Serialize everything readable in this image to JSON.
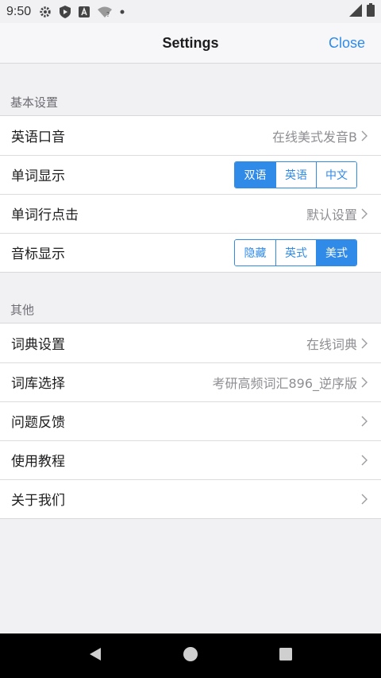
{
  "status_bar": {
    "time": "9:50",
    "icons": [
      "gear-icon",
      "play-shield-icon",
      "a-box-icon",
      "wifi-question-icon",
      "dot-icon"
    ],
    "right_icons": [
      "signal-icon",
      "battery-icon"
    ]
  },
  "nav": {
    "title": "Settings",
    "close_label": "Close"
  },
  "sections": [
    {
      "header": "基本设置",
      "rows": [
        {
          "label": "英语口音",
          "value": "在线美式发音B"
        },
        {
          "label": "单词显示",
          "options": [
            "双语",
            "英语",
            "中文"
          ],
          "selected": "双语"
        },
        {
          "label": "单词行点击",
          "value": "默认设置"
        },
        {
          "label": "音标显示",
          "options": [
            "隐藏",
            "英式",
            "美式"
          ],
          "selected": "美式"
        }
      ]
    },
    {
      "header": "其他",
      "rows": [
        {
          "label": "词典设置",
          "value": "在线词典"
        },
        {
          "label": "词库选择",
          "value": "考研高频词汇896_逆序版"
        },
        {
          "label": "问题反馈",
          "value": ""
        },
        {
          "label": "使用教程",
          "value": ""
        },
        {
          "label": "关于我们",
          "value": ""
        }
      ]
    }
  ],
  "colors": {
    "accent": "#2f8ae8",
    "background": "#f1f1f4"
  },
  "system_nav": [
    "back-icon",
    "home-icon",
    "recents-icon"
  ]
}
